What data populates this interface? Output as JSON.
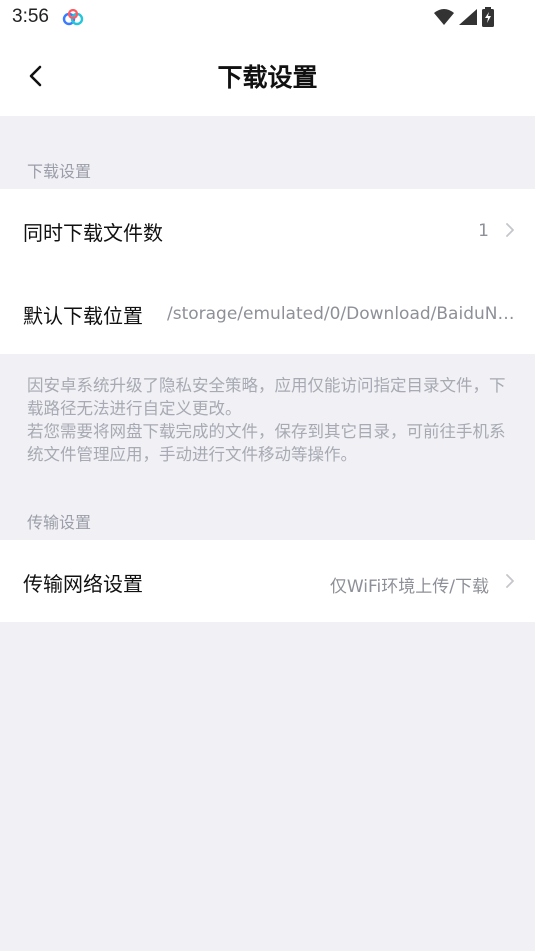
{
  "status_bar": {
    "time": "3:56"
  },
  "header": {
    "title": "下载设置"
  },
  "sections": {
    "download": {
      "label": "下载设置",
      "rows": [
        {
          "label": "同时下载文件数",
          "value": "1"
        },
        {
          "label": "默认下载位置",
          "value": "/storage/emulated/0/Download/BaiduNet…"
        }
      ]
    },
    "transfer": {
      "label": "传输设置",
      "rows": [
        {
          "label": "传输网络设置",
          "value": "仅WiFi环境上传/下载"
        }
      ]
    }
  },
  "notes": [
    "因安卓系统升级了隐私安全策略，应用仅能访问指定目录文件，下载路径无法进行自定义更改。",
    "若您需要将网盘下载完成的文件，保存到其它目录，可前往手机系统文件管理应用，手动进行文件移动等操作。"
  ],
  "colors": {
    "background": "#f0f0f5",
    "card": "#ffffff",
    "muted_text": "#9b9ea8"
  }
}
